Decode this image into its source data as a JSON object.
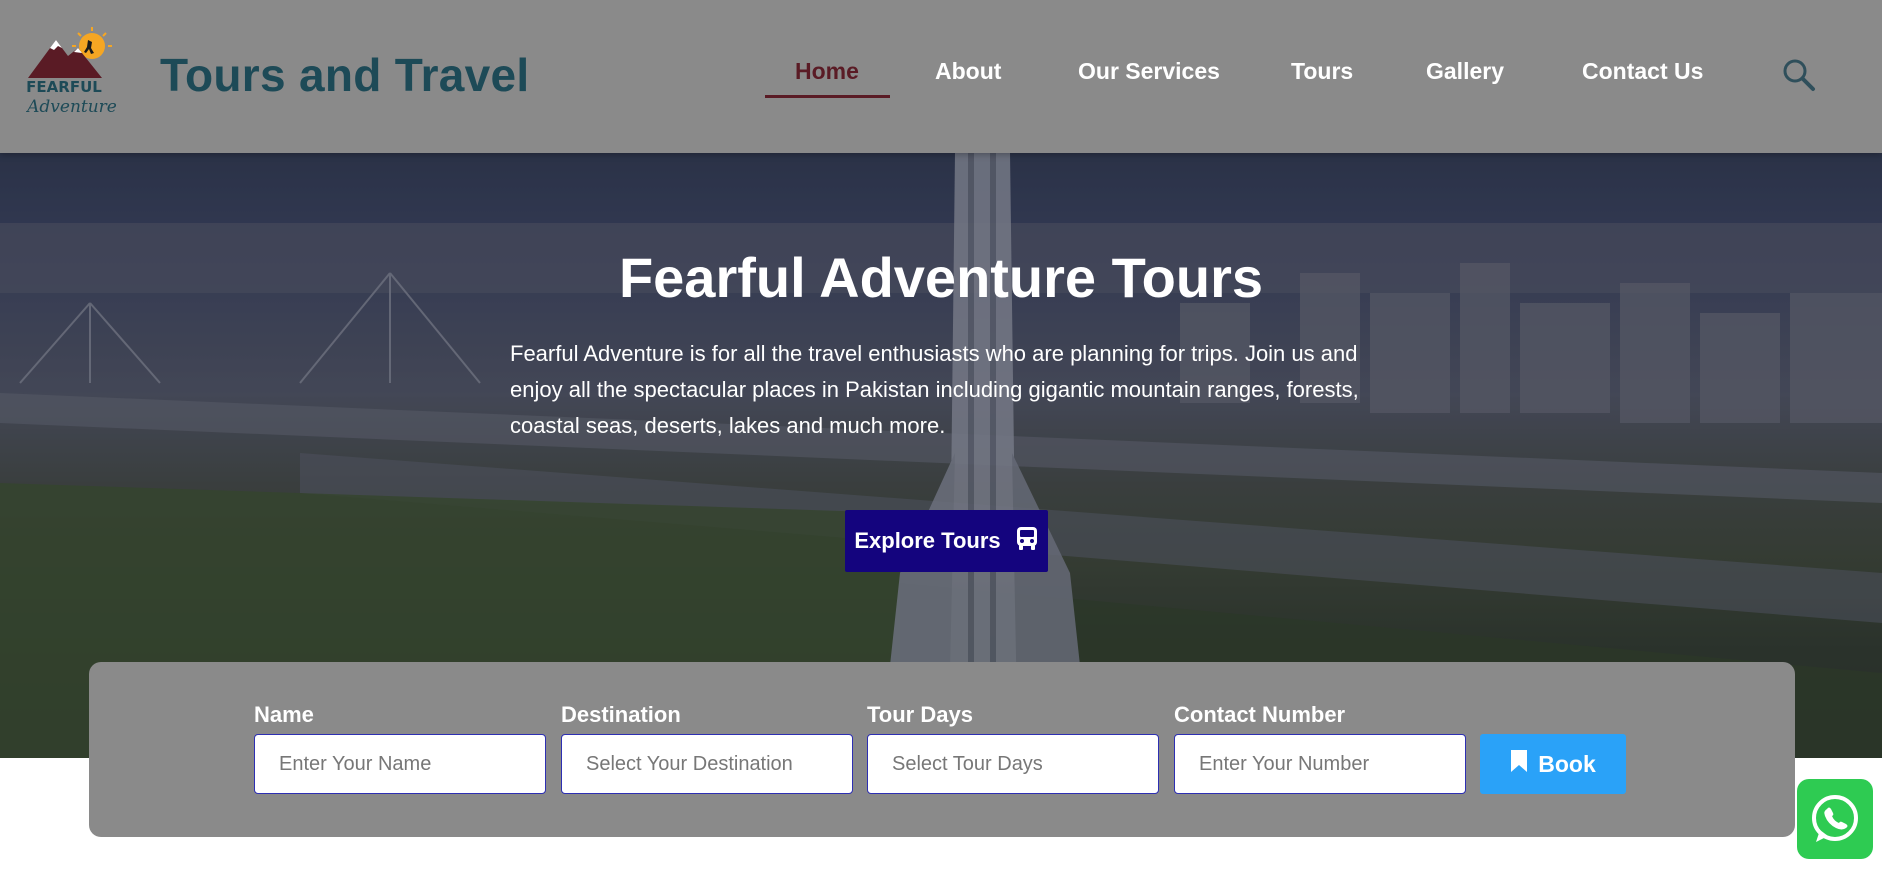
{
  "header": {
    "brand": "Tours and Travel",
    "logo_text_top": "FEARFUL",
    "logo_text_bottom": "Adventure"
  },
  "nav": {
    "items": [
      {
        "label": "Home",
        "active": true
      },
      {
        "label": "About"
      },
      {
        "label": "Our Services"
      },
      {
        "label": "Tours"
      },
      {
        "label": "Gallery"
      },
      {
        "label": "Contact Us"
      }
    ]
  },
  "hero": {
    "title": "Fearful Adventure Tours",
    "description": "Fearful Adventure is for all the travel enthusiasts who are planning for trips. Join us and enjoy all the spectacular places in Pakistan including gigantic mountain ranges, forests, coastal seas, deserts, lakes and much more.",
    "cta_label": "Explore Tours"
  },
  "booking": {
    "fields": [
      {
        "label": "Name",
        "placeholder": "Enter Your Name"
      },
      {
        "label": "Destination",
        "placeholder": "Select Your Destination"
      },
      {
        "label": "Tour Days",
        "placeholder": "Select Tour Days"
      },
      {
        "label": "Contact Number",
        "placeholder": "Enter Your Number"
      }
    ],
    "submit_label": "Book"
  },
  "icons": {
    "search": "search-icon",
    "bus": "bus-icon",
    "bookmark": "bookmark-icon",
    "whatsapp": "whatsapp-icon"
  },
  "colors": {
    "header_bg": "#8a8a8a",
    "brand": "#1d4a57",
    "nav_active": "#5a1b25",
    "cta_bg": "#14047e",
    "book_bg": "#2aa2f8",
    "whatsapp": "#2ecb52"
  }
}
